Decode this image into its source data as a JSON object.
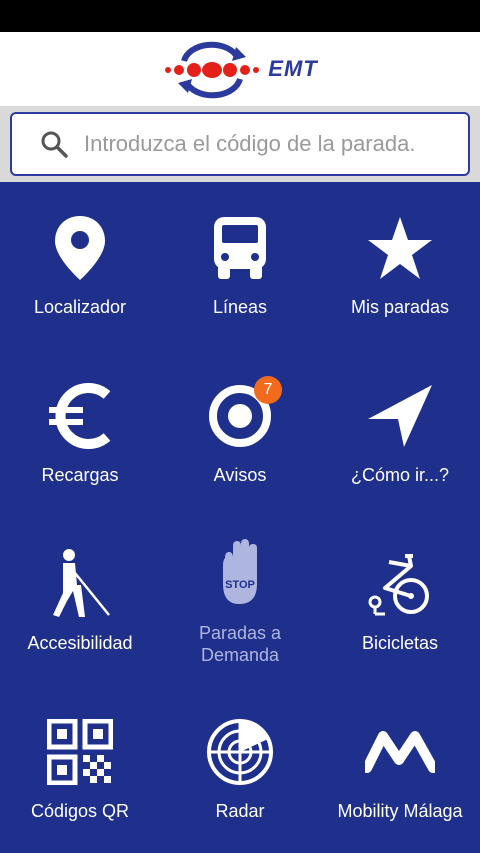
{
  "header": {
    "logo_text": "EMT",
    "brand_colors": {
      "red": "#e32119",
      "blue": "#2b3a9c"
    }
  },
  "search": {
    "placeholder": "Introduzca el código de la parada.",
    "icon": "search-icon"
  },
  "menu": {
    "items": [
      {
        "label": "Localizador",
        "icon": "location-pin-icon"
      },
      {
        "label": "Líneas",
        "icon": "bus-icon"
      },
      {
        "label": "Mis paradas",
        "icon": "star-icon"
      },
      {
        "label": "Recargas",
        "icon": "euro-icon"
      },
      {
        "label": "Avisos",
        "icon": "alert-target-icon",
        "badge": "7"
      },
      {
        "label": "¿Cómo ir...?",
        "icon": "navigation-arrow-icon"
      },
      {
        "label": "Accesibilidad",
        "icon": "blind-person-icon"
      },
      {
        "label": "Paradas a Demanda",
        "icon": "stop-hand-icon",
        "disabled_sign": "STOP"
      },
      {
        "label": "Bicicletas",
        "icon": "bicycle-icon"
      },
      {
        "label": "Códigos QR",
        "icon": "qr-code-icon"
      },
      {
        "label": "Radar",
        "icon": "radar-icon"
      },
      {
        "label": "Mobility Málaga",
        "icon": "mobility-logo-icon"
      }
    ]
  },
  "colors": {
    "background": "#1e2f8c",
    "badge": "#f26b1d",
    "disabled_text": "#aeb6e0"
  }
}
